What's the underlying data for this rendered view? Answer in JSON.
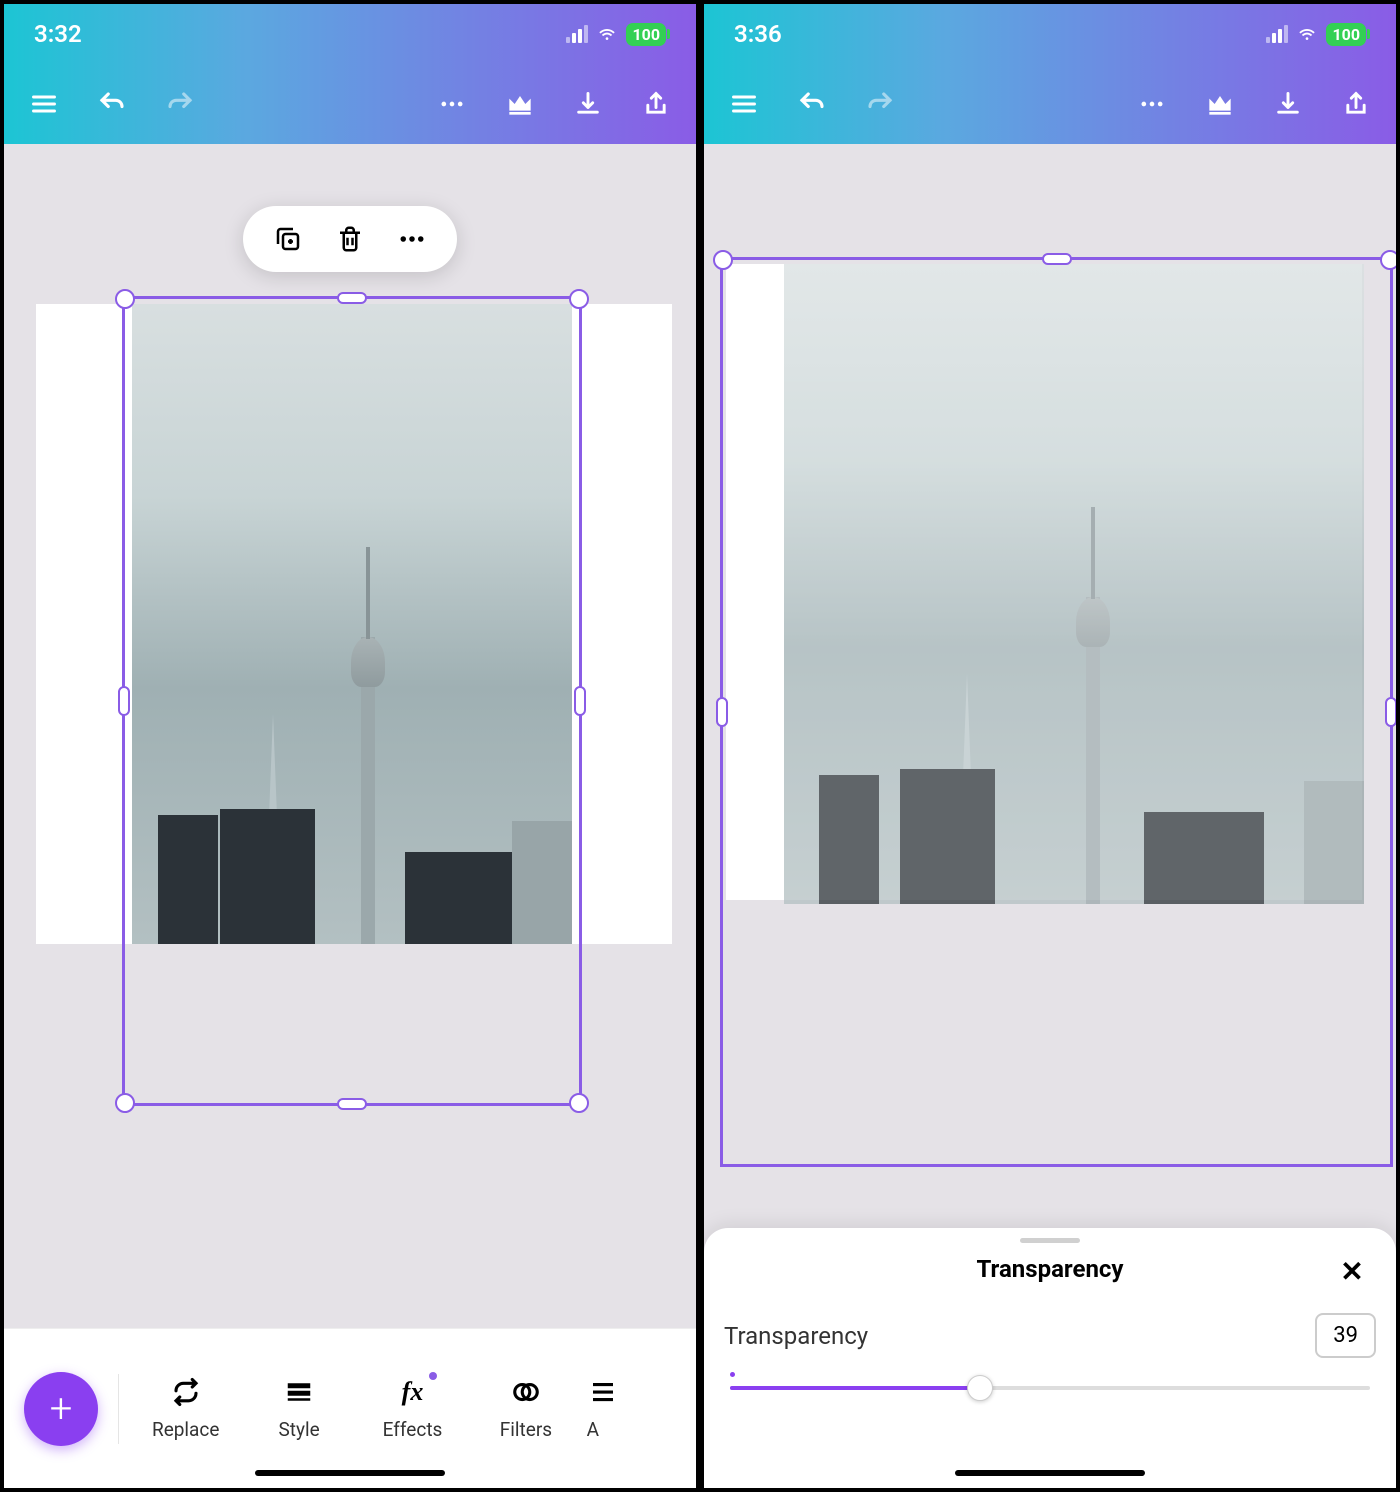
{
  "left": {
    "status": {
      "time": "3:32",
      "battery": "100"
    },
    "context_menu": {
      "duplicate": "duplicate",
      "delete": "delete",
      "more": "more"
    },
    "tools": [
      {
        "id": "replace",
        "label": "Replace"
      },
      {
        "id": "style",
        "label": "Style"
      },
      {
        "id": "effects",
        "label": "Effects",
        "dot": true
      },
      {
        "id": "filters",
        "label": "Filters"
      },
      {
        "id": "adjust",
        "label": "A"
      }
    ],
    "fab": "+"
  },
  "right": {
    "status": {
      "time": "3:36",
      "battery": "100"
    },
    "panel": {
      "title": "Transparency",
      "label": "Transparency",
      "value": "39",
      "slider_percent": 39
    }
  },
  "colors": {
    "accent": "#8a5ce6",
    "fab": "#8a3ff0"
  }
}
